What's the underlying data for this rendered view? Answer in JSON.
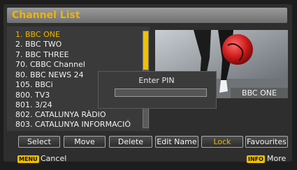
{
  "window": {
    "title": "Channel List"
  },
  "channels": [
    "1. BBC ONE",
    "2. BBC TWO",
    "7. BBC THREE",
    "70. CBBC Channel",
    "80. BBC NEWS 24",
    "105. BBCi",
    "800. TV3",
    "801. 3/24",
    "802. CATALUNYA RÀDIO",
    "803. CATALUNYA INFORMACIÓ"
  ],
  "selected_index": 0,
  "preview": {
    "channel_label": "BBC ONE"
  },
  "pin_dialog": {
    "title": "Enter PIN",
    "value": ""
  },
  "buttons": [
    "Select",
    "Move",
    "Delete",
    "Edit Name",
    "Lock",
    "Favourites"
  ],
  "active_button": "Lock",
  "footer": {
    "left_key": "MENU",
    "left_label": "Cancel",
    "right_key": "INFO",
    "right_label": "More"
  },
  "colors": {
    "accent": "#f0b400",
    "background": "#2e2e2e"
  }
}
